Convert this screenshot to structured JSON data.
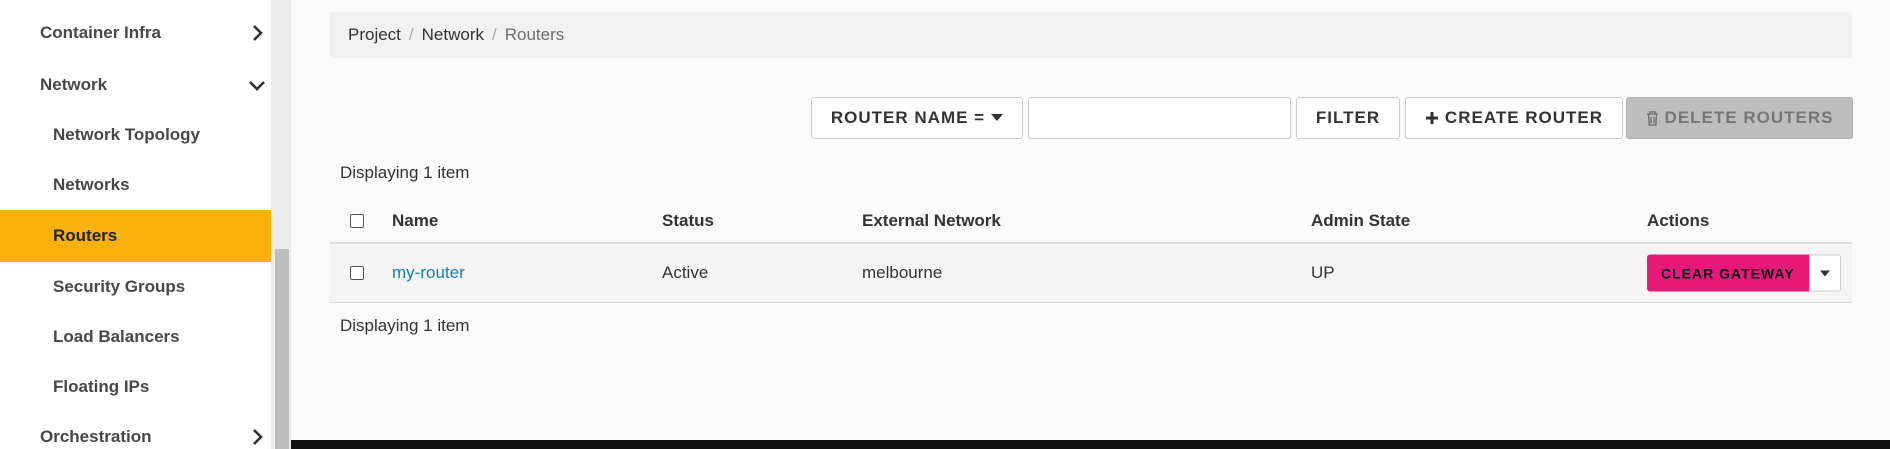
{
  "sidebar": {
    "items": [
      {
        "label": "Container Infra",
        "chevron": "chevron-right"
      },
      {
        "label": "Network",
        "chevron": "chevron-down"
      },
      {
        "label": "Network Topology"
      },
      {
        "label": "Networks"
      },
      {
        "label": "Routers",
        "active": true
      },
      {
        "label": "Security Groups"
      },
      {
        "label": "Load Balancers"
      },
      {
        "label": "Floating IPs"
      },
      {
        "label": "Orchestration",
        "chevron": "chevron-right"
      }
    ]
  },
  "breadcrumb": {
    "items": [
      "Project",
      "Network",
      "Routers"
    ],
    "separator": "/"
  },
  "toolbar": {
    "filter_field_label": "ROUTER NAME =",
    "filter_value": "",
    "filter_button": "FILTER",
    "create_button": "CREATE ROUTER",
    "delete_button": "DELETE ROUTERS"
  },
  "table": {
    "count_top": "Displaying 1 item",
    "count_bottom": "Displaying 1 item",
    "columns": [
      "Name",
      "Status",
      "External Network",
      "Admin State",
      "Actions"
    ],
    "rows": [
      {
        "name": "my-router",
        "status": "Active",
        "external_network": "melbourne",
        "admin_state": "UP",
        "action_label": "CLEAR GATEWAY"
      }
    ]
  },
  "colors": {
    "active_nav": "#f7b10f",
    "danger": "#e6197a",
    "link": "#1a7ea6"
  }
}
